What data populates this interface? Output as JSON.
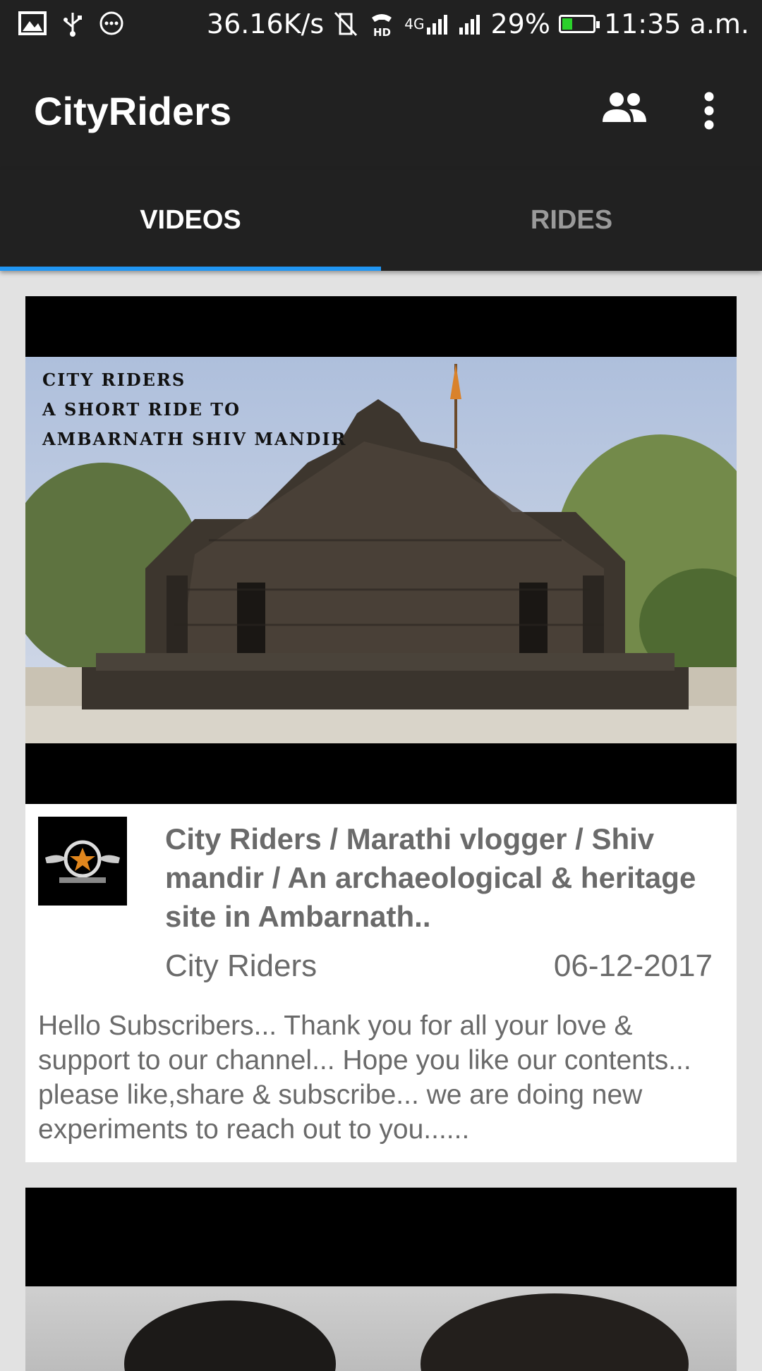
{
  "status_bar": {
    "speed": "36.16K/s",
    "network": "4G",
    "battery": "29%",
    "battery_level": 0.29,
    "time": "11:35 a.m.",
    "icons": [
      "image-icon",
      "usb-icon",
      "chat-bubble-icon",
      "vibrate-off-icon",
      "hd-call-icon",
      "signal-icon",
      "signal-icon",
      "battery-icon"
    ]
  },
  "app_bar": {
    "title": "CityRiders",
    "actions": [
      "people-icon",
      "more-vert-icon"
    ]
  },
  "tabs": [
    {
      "label": "VIDEOS",
      "active": true
    },
    {
      "label": "RIDES",
      "active": false
    }
  ],
  "videos": [
    {
      "thumbnail_text": [
        "CITY RIDERS",
        "A SHORT RIDE TO",
        "AMBARNATH SHIV MANDIR"
      ],
      "title": "City Riders / Marathi vlogger / Shiv mandir / An archaeological & heritage site in Ambarnath..",
      "channel": "City Riders",
      "date": "06-12-2017",
      "description": "Hello Subscribers... Thank you for all your love & support to our channel... Hope you like our contents... please like,share & subscribe... we are doing new experiments to reach out to you......"
    }
  ],
  "colors": {
    "bar": "#212121",
    "accent": "#2196f3",
    "background": "#e2e2e2",
    "battery_fill": "#2bd12b"
  }
}
